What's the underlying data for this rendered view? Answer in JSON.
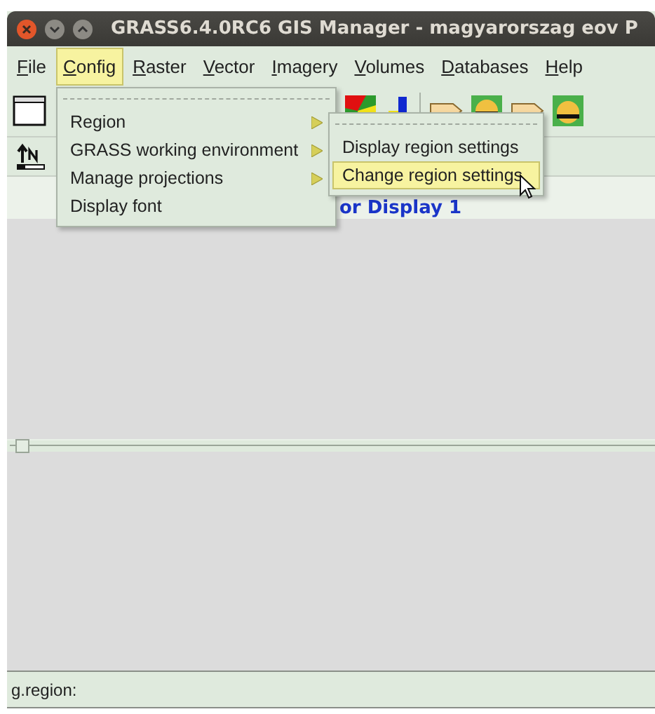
{
  "window": {
    "title": "GRASS6.4.0RC6 GIS Manager - magyarorszag eov P"
  },
  "menubar": [
    {
      "key": "F",
      "rest": "ile",
      "selected": false
    },
    {
      "key": "C",
      "rest": "onfig",
      "selected": true
    },
    {
      "key": "R",
      "rest": "aster",
      "selected": false
    },
    {
      "key": "V",
      "rest": "ector",
      "selected": false
    },
    {
      "key": "I",
      "rest": "magery",
      "selected": false
    },
    {
      "key": "V",
      "rest": "olumes",
      "selected": false
    },
    {
      "key": "D",
      "rest": "atabases",
      "selected": false
    },
    {
      "key": "H",
      "rest": "elp",
      "selected": false
    }
  ],
  "config_menu": [
    {
      "label": "Region",
      "kind": "submenu",
      "selected": false
    },
    {
      "label": "GRASS working environment",
      "kind": "submenu",
      "selected": false
    },
    {
      "label": "Manage projections",
      "kind": "submenu",
      "selected": false
    },
    {
      "label": "Display font",
      "kind": "item",
      "selected": false
    }
  ],
  "region_submenu": [
    {
      "label": "Display region settings",
      "selected": false
    },
    {
      "label": "Change region settings",
      "selected": true
    }
  ],
  "panel_heading": "or Display 1",
  "status_bar": "g.region:"
}
